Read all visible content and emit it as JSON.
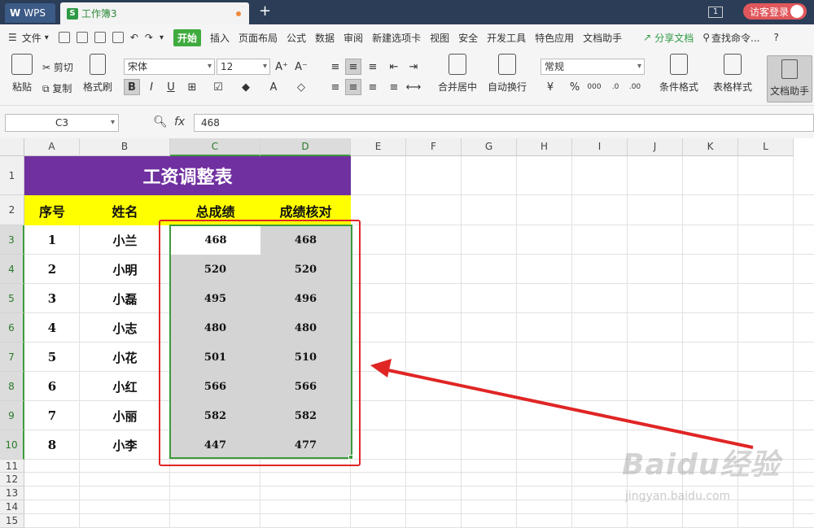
{
  "titlebar": {
    "app_label": "WPS",
    "doc_tab": "工作簿3",
    "window_badge": "1",
    "login": "访客登录"
  },
  "menubar": {
    "file": "文件",
    "tabs": [
      "开始",
      "插入",
      "页面布局",
      "公式",
      "数据",
      "审阅",
      "新建选项卡",
      "视图",
      "安全",
      "开发工具",
      "特色应用",
      "文档助手"
    ],
    "share": "分享文档",
    "search": "查找命令...",
    "help": "?"
  },
  "ribbon": {
    "paste": "粘贴",
    "cut": "剪切",
    "copy": "复制",
    "format_painter": "格式刷",
    "font_name": "宋体",
    "font_size": "12",
    "merge_center": "合并居中",
    "wrap_text": "自动换行",
    "number_format": "常规",
    "conditional_format": "条件格式",
    "table_style": "表格样式",
    "doc_assistant": "文档助手"
  },
  "formula_bar": {
    "name_box": "C3",
    "fx": "fx",
    "value": "468"
  },
  "columns": [
    "A",
    "B",
    "C",
    "D",
    "E",
    "F",
    "G",
    "H",
    "I",
    "J",
    "K",
    "L"
  ],
  "rows": [
    "1",
    "2",
    "3",
    "4",
    "5",
    "6",
    "7",
    "8",
    "9",
    "10",
    "11",
    "12",
    "13",
    "14",
    "15"
  ],
  "sheet": {
    "title": "工资调整表",
    "headers": [
      "序号",
      "姓名",
      "总成绩",
      "成绩核对"
    ],
    "data": [
      [
        "1",
        "小兰",
        "468",
        "468"
      ],
      [
        "2",
        "小明",
        "520",
        "520"
      ],
      [
        "3",
        "小磊",
        "495",
        "496"
      ],
      [
        "4",
        "小志",
        "480",
        "480"
      ],
      [
        "5",
        "小花",
        "501",
        "510"
      ],
      [
        "6",
        "小红",
        "566",
        "566"
      ],
      [
        "7",
        "小丽",
        "582",
        "582"
      ],
      [
        "8",
        "小李",
        "447",
        "477"
      ]
    ]
  },
  "colors": {
    "title_bg": "#7030a0",
    "header_bg": "#ffff00",
    "selection_border": "#3d9a3d",
    "annotation": "#e02525"
  },
  "watermark": {
    "brand": "Baidu经验",
    "url": "jingyan.baidu.com"
  }
}
